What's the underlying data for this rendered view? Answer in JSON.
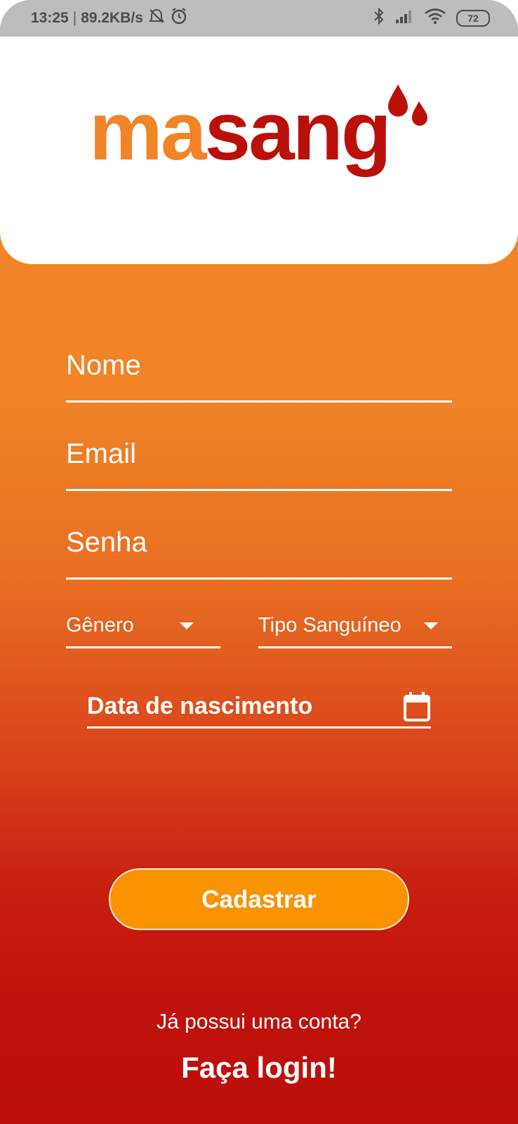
{
  "status_bar": {
    "time": "13:25",
    "separator": "|",
    "network_speed": "89.2KB/s",
    "icons": [
      "notifications-off-icon",
      "alarm-icon",
      "bluetooth-icon",
      "signal-icon",
      "wifi-icon",
      "battery-icon"
    ],
    "battery_level": "72"
  },
  "brand": {
    "logo_part_1": "ma",
    "logo_part_2": "sang",
    "color_orange": "#f08427",
    "color_red": "#bb0f09"
  },
  "form": {
    "name_placeholder": "Nome",
    "email_placeholder": "Email",
    "password_placeholder": "Senha",
    "gender_label": "Gênero",
    "blood_type_label": "Tipo Sanguíneo",
    "birth_date_label": "Data de nascimento",
    "submit_label": "Cadastrar"
  },
  "footer": {
    "question": "Já possui uma conta?",
    "login_link": "Faça login!"
  },
  "colors": {
    "background_top": "#f08427",
    "background_bottom": "#bb0f09",
    "button": "#fb9200",
    "status_bar": "#bdbdbd"
  }
}
